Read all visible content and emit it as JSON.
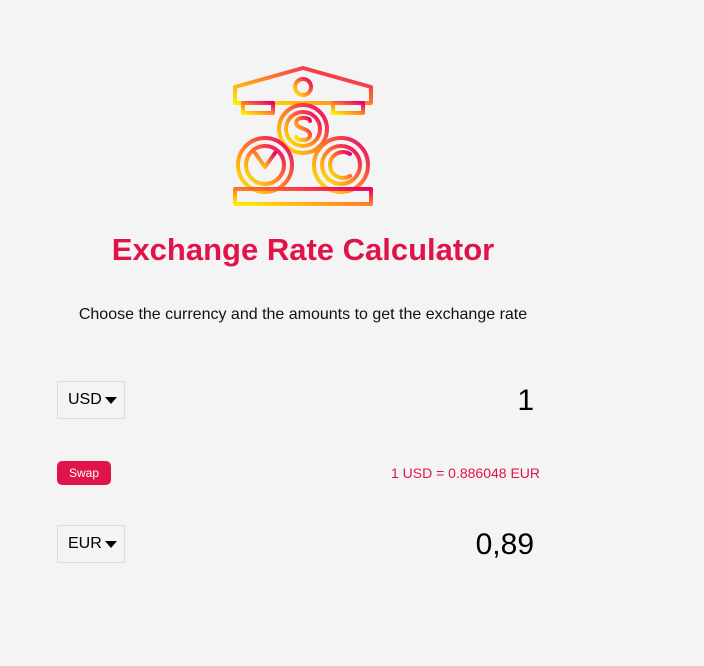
{
  "header": {
    "title": "Exchange Rate Calculator",
    "subtitle": "Choose the currency and the amounts to get the exchange rate"
  },
  "converter": {
    "currency_one": "USD",
    "amount_one": "1",
    "swap_label": "Swap",
    "rate_text": "1 USD = 0.886048 EUR",
    "currency_two": "EUR",
    "amount_two": "0,89"
  },
  "icons": {
    "logo": "bank-currency-icon",
    "dropdown": "caret-down-icon"
  },
  "colors": {
    "accent": "#e1144a",
    "background": "#f4f4f4",
    "gradient_start": "#ffee00",
    "gradient_end": "#e8006d"
  }
}
